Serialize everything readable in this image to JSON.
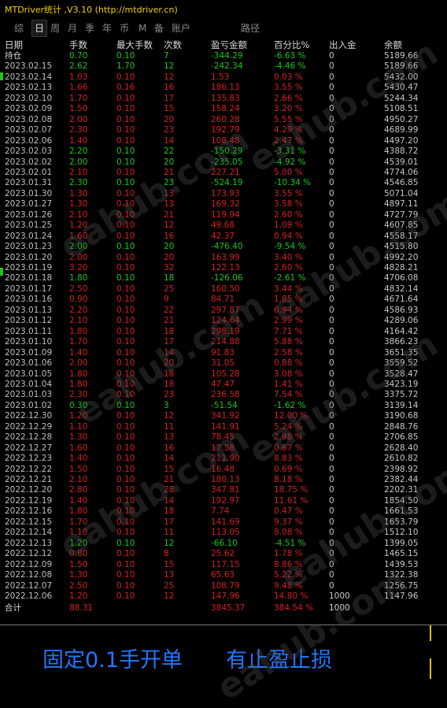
{
  "titlebar": {
    "title": "MTDriver统计 ,V3.10 (http://mtdriver.cn)"
  },
  "tabs": [
    "综",
    "日",
    "周",
    "月",
    "季",
    "年",
    "币",
    "M",
    "备",
    "账户",
    "路径"
  ],
  "active_tab": "日",
  "table": {
    "headers": [
      "日期",
      "手数",
      "最大手数",
      "次数",
      "盈亏金额",
      "百分比%",
      "出入金",
      "余额"
    ],
    "rows": [
      {
        "d": "持仓",
        "lots": "0.70",
        "max": "0.10",
        "n": "7",
        "pnl": "-344.29",
        "pct": "-6.63 %",
        "io": "0",
        "bal": "5189.66",
        "c": "green"
      },
      {
        "d": "2023.02.15",
        "lots": "2.62",
        "max": "1.70",
        "n": "12",
        "pnl": "-242.34",
        "pct": "-4.46 %",
        "io": "0",
        "bal": "5189.66",
        "c": "green"
      },
      {
        "d": "2023.02.14",
        "lots": "1.03",
        "max": "0.10",
        "n": "12",
        "pnl": "1.53",
        "pct": "0.03 %",
        "io": "0",
        "bal": "5432.00",
        "c": "red"
      },
      {
        "d": "2023.02.13",
        "lots": "1.66",
        "max": "0.16",
        "n": "16",
        "pnl": "186.13",
        "pct": "3.55 %",
        "io": "0",
        "bal": "5430.47",
        "c": "red"
      },
      {
        "d": "2023.02.10",
        "lots": "1.70",
        "max": "0.10",
        "n": "17",
        "pnl": "135.83",
        "pct": "2.66 %",
        "io": "0",
        "bal": "5244.34",
        "c": "red"
      },
      {
        "d": "2023.02.09",
        "lots": "1.50",
        "max": "0.10",
        "n": "15",
        "pnl": "158.24",
        "pct": "3.20 %",
        "io": "0",
        "bal": "5108.51",
        "c": "red"
      },
      {
        "d": "2023.02.08",
        "lots": "2.00",
        "max": "0.10",
        "n": "20",
        "pnl": "260.28",
        "pct": "5.55 %",
        "io": "0",
        "bal": "4950.27",
        "c": "red"
      },
      {
        "d": "2023.02.07",
        "lots": "2.30",
        "max": "0.10",
        "n": "23",
        "pnl": "192.79",
        "pct": "4.29 %",
        "io": "0",
        "bal": "4689.99",
        "c": "red"
      },
      {
        "d": "2023.02.06",
        "lots": "1.40",
        "max": "0.10",
        "n": "14",
        "pnl": "108.48",
        "pct": "2.47 %",
        "io": "0",
        "bal": "4497.20",
        "c": "red"
      },
      {
        "d": "2023.02.03",
        "lots": "2.20",
        "max": "0.10",
        "n": "22",
        "pnl": "-150.29",
        "pct": "-3.31 %",
        "io": "0",
        "bal": "4388.72",
        "c": "green"
      },
      {
        "d": "2023.02.02",
        "lots": "2.00",
        "max": "0.10",
        "n": "20",
        "pnl": "-235.05",
        "pct": "-4.92 %",
        "io": "0",
        "bal": "4539.01",
        "c": "green"
      },
      {
        "d": "2023.02.01",
        "lots": "2.10",
        "max": "0.10",
        "n": "21",
        "pnl": "227.21",
        "pct": "5.00 %",
        "io": "0",
        "bal": "4774.06",
        "c": "red"
      },
      {
        "d": "2023.01.31",
        "lots": "2.30",
        "max": "0.10",
        "n": "23",
        "pnl": "-524.19",
        "pct": "-10.34 %",
        "io": "0",
        "bal": "4546.85",
        "c": "green"
      },
      {
        "d": "2023.01.30",
        "lots": "1.30",
        "max": "0.10",
        "n": "13",
        "pnl": "173.93",
        "pct": "3.55 %",
        "io": "0",
        "bal": "5071.04",
        "c": "red"
      },
      {
        "d": "2023.01.27",
        "lots": "1.30",
        "max": "0.10",
        "n": "13",
        "pnl": "169.32",
        "pct": "3.58 %",
        "io": "0",
        "bal": "4897.11",
        "c": "red"
      },
      {
        "d": "2023.01.26",
        "lots": "2.10",
        "max": "0.10",
        "n": "21",
        "pnl": "119.94",
        "pct": "2.60 %",
        "io": "0",
        "bal": "4727.79",
        "c": "red"
      },
      {
        "d": "2023.01.25",
        "lots": "1.20",
        "max": "0.10",
        "n": "12",
        "pnl": "49.68",
        "pct": "1.09 %",
        "io": "0",
        "bal": "4607.85",
        "c": "red"
      },
      {
        "d": "2023.01.24",
        "lots": "1.60",
        "max": "0.10",
        "n": "16",
        "pnl": "42.37",
        "pct": "0.94 %",
        "io": "0",
        "bal": "4558.17",
        "c": "red"
      },
      {
        "d": "2023.01.23",
        "lots": "2.00",
        "max": "0.10",
        "n": "20",
        "pnl": "-476.40",
        "pct": "-9.54 %",
        "io": "0",
        "bal": "4515.80",
        "c": "green"
      },
      {
        "d": "2023.01.20",
        "lots": "2.00",
        "max": "0.10",
        "n": "20",
        "pnl": "163.99",
        "pct": "3.40 %",
        "io": "0",
        "bal": "4992.20",
        "c": "red"
      },
      {
        "d": "2023.01.19",
        "lots": "3.20",
        "max": "0.10",
        "n": "32",
        "pnl": "122.13",
        "pct": "2.60 %",
        "io": "0",
        "bal": "4828.21",
        "c": "red"
      },
      {
        "d": "2023.01.18",
        "lots": "1.80",
        "max": "0.10",
        "n": "18",
        "pnl": "-126.06",
        "pct": "-2.61 %",
        "io": "0",
        "bal": "4706.08",
        "c": "green"
      },
      {
        "d": "2023.01.17",
        "lots": "2.50",
        "max": "0.10",
        "n": "25",
        "pnl": "160.50",
        "pct": "3.44 %",
        "io": "0",
        "bal": "4832.14",
        "c": "red"
      },
      {
        "d": "2023.01.16",
        "lots": "0.90",
        "max": "0.10",
        "n": "9",
        "pnl": "84.71",
        "pct": "1.85 %",
        "io": "0",
        "bal": "4671.64",
        "c": "red"
      },
      {
        "d": "2023.01.13",
        "lots": "2.20",
        "max": "0.10",
        "n": "22",
        "pnl": "297.87",
        "pct": "6.94 %",
        "io": "0",
        "bal": "4586.93",
        "c": "red"
      },
      {
        "d": "2023.01.12",
        "lots": "2.10",
        "max": "0.10",
        "n": "21",
        "pnl": "124.64",
        "pct": "2.99 %",
        "io": "0",
        "bal": "4289.06",
        "c": "red"
      },
      {
        "d": "2023.01.11",
        "lots": "1.80",
        "max": "0.10",
        "n": "18",
        "pnl": "298.19",
        "pct": "7.71 %",
        "io": "0",
        "bal": "4164.42",
        "c": "red"
      },
      {
        "d": "2023.01.10",
        "lots": "1.70",
        "max": "0.10",
        "n": "17",
        "pnl": "214.88",
        "pct": "5.88 %",
        "io": "0",
        "bal": "3866.23",
        "c": "red"
      },
      {
        "d": "2023.01.09",
        "lots": "1.40",
        "max": "0.10",
        "n": "14",
        "pnl": "91.83",
        "pct": "2.58 %",
        "io": "0",
        "bal": "3651.35",
        "c": "red"
      },
      {
        "d": "2023.01.06",
        "lots": "2.00",
        "max": "0.10",
        "n": "20",
        "pnl": "31.05",
        "pct": "0.88 %",
        "io": "0",
        "bal": "3559.52",
        "c": "red"
      },
      {
        "d": "2023.01.05",
        "lots": "1.80",
        "max": "0.10",
        "n": "18",
        "pnl": "105.28",
        "pct": "3.08 %",
        "io": "0",
        "bal": "3528.47",
        "c": "red"
      },
      {
        "d": "2023.01.04",
        "lots": "1.80",
        "max": "0.10",
        "n": "18",
        "pnl": "47.47",
        "pct": "1.41 %",
        "io": "0",
        "bal": "3423.19",
        "c": "red"
      },
      {
        "d": "2023.01.03",
        "lots": "2.30",
        "max": "0.10",
        "n": "23",
        "pnl": "236.58",
        "pct": "7.54 %",
        "io": "0",
        "bal": "3375.72",
        "c": "red"
      },
      {
        "d": "2023.01.02",
        "lots": "0.30",
        "max": "0.10",
        "n": "3",
        "pnl": "-51.54",
        "pct": "-1.62 %",
        "io": "0",
        "bal": "3139.14",
        "c": "green"
      },
      {
        "d": "2022.12.30",
        "lots": "1.20",
        "max": "0.10",
        "n": "12",
        "pnl": "341.92",
        "pct": "12.00 %",
        "io": "0",
        "bal": "3190.68",
        "c": "red"
      },
      {
        "d": "2022.12.29",
        "lots": "1.10",
        "max": "0.10",
        "n": "11",
        "pnl": "141.91",
        "pct": "5.24 %",
        "io": "0",
        "bal": "2848.76",
        "c": "red"
      },
      {
        "d": "2022.12.28",
        "lots": "1.30",
        "max": "0.10",
        "n": "13",
        "pnl": "78.45",
        "pct": "2.98 %",
        "io": "0",
        "bal": "2706.85",
        "c": "red"
      },
      {
        "d": "2022.12.27",
        "lots": "1.60",
        "max": "0.10",
        "n": "16",
        "pnl": "17.58",
        "pct": "0.67 %",
        "io": "0",
        "bal": "2628.40",
        "c": "red"
      },
      {
        "d": "2022.12.23",
        "lots": "1.40",
        "max": "0.10",
        "n": "14",
        "pnl": "211.90",
        "pct": "8.83 %",
        "io": "0",
        "bal": "2610.82",
        "c": "red"
      },
      {
        "d": "2022.12.22",
        "lots": "1.50",
        "max": "0.10",
        "n": "15",
        "pnl": "16.48",
        "pct": "0.69 %",
        "io": "0",
        "bal": "2398.92",
        "c": "red"
      },
      {
        "d": "2022.12.21",
        "lots": "2.10",
        "max": "0.10",
        "n": "21",
        "pnl": "180.13",
        "pct": "8.18 %",
        "io": "0",
        "bal": "2382.44",
        "c": "red"
      },
      {
        "d": "2022.12.20",
        "lots": "2.80",
        "max": "0.10",
        "n": "28",
        "pnl": "347.81",
        "pct": "18.75 %",
        "io": "0",
        "bal": "2202.31",
        "c": "red"
      },
      {
        "d": "2022.12.19",
        "lots": "1.40",
        "max": "0.10",
        "n": "14",
        "pnl": "192.97",
        "pct": "11.61 %",
        "io": "0",
        "bal": "1854.50",
        "c": "red"
      },
      {
        "d": "2022.12.16",
        "lots": "1.80",
        "max": "0.10",
        "n": "18",
        "pnl": "7.74",
        "pct": "0.47 %",
        "io": "0",
        "bal": "1661.53",
        "c": "red"
      },
      {
        "d": "2022.12.15",
        "lots": "1.70",
        "max": "0.10",
        "n": "17",
        "pnl": "141.69",
        "pct": "9.37 %",
        "io": "0",
        "bal": "1653.79",
        "c": "red"
      },
      {
        "d": "2022.12.14",
        "lots": "1.10",
        "max": "0.10",
        "n": "11",
        "pnl": "113.05",
        "pct": "8.08 %",
        "io": "0",
        "bal": "1512.10",
        "c": "red"
      },
      {
        "d": "2022.12.13",
        "lots": "1.20",
        "max": "0.10",
        "n": "12",
        "pnl": "-66.10",
        "pct": "-4.51 %",
        "io": "0",
        "bal": "1399.05",
        "c": "green"
      },
      {
        "d": "2022.12.12",
        "lots": "0.80",
        "max": "0.10",
        "n": "8",
        "pnl": "25.62",
        "pct": "1.78 %",
        "io": "0",
        "bal": "1465.15",
        "c": "red"
      },
      {
        "d": "2022.12.09",
        "lots": "1.50",
        "max": "0.10",
        "n": "15",
        "pnl": "117.15",
        "pct": "8.86 %",
        "io": "0",
        "bal": "1439.53",
        "c": "red"
      },
      {
        "d": "2022.12.08",
        "lots": "1.30",
        "max": "0.10",
        "n": "13",
        "pnl": "65.63",
        "pct": "5.22 %",
        "io": "0",
        "bal": "1322.38",
        "c": "red"
      },
      {
        "d": "2022.12.07",
        "lots": "2.50",
        "max": "0.10",
        "n": "25",
        "pnl": "108.79",
        "pct": "9.48 %",
        "io": "0",
        "bal": "1256.75",
        "c": "red"
      },
      {
        "d": "2022.12.06",
        "lots": "1.20",
        "max": "0.10",
        "n": "12",
        "pnl": "147.96",
        "pct": "14.80 %",
        "io": "1000",
        "bal": "1147.96",
        "c": "red"
      }
    ],
    "total": {
      "label": "合计",
      "lots": "88.31",
      "pnl": "3845.37",
      "pct": "384.54 %",
      "io": "1000"
    }
  },
  "banner": {
    "left": "固定0.1手开单",
    "right": "有止盈止损"
  },
  "watermark": "eahub.com",
  "colors": {
    "profit": "#d42020",
    "loss": "#18c818",
    "title": "#f0d000",
    "banner": "#1e78ff"
  }
}
